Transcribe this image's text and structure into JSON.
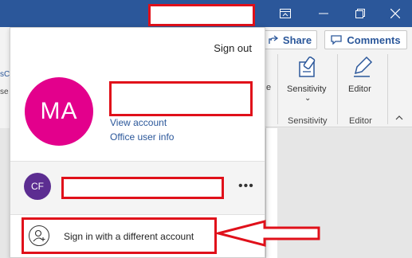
{
  "window": {
    "controls": {
      "ribbon_display_icon": "ribbon-display-icon",
      "minimize_icon": "minimize-icon",
      "restore_icon": "restore-icon",
      "close_icon": "close-icon"
    }
  },
  "toolbar": {
    "share_label": "Share",
    "comments_label": "Comments"
  },
  "ribbon": {
    "sensitivity_button": "Sensitivity",
    "sensitivity_dropdown": "⌄",
    "sensitivity_group": "Sensitivity",
    "editor_button": "Editor",
    "editor_group": "Editor",
    "left_cut_text_1": "sCo",
    "left_cut_text_2": "se",
    "left_cut_text_3": "e"
  },
  "account_panel": {
    "sign_out": "Sign out",
    "avatar_initials": "MA",
    "view_account": "View account",
    "office_user_info": "Office user info",
    "other_account_initials": "CF",
    "more_options": "•••",
    "sign_in_different": "Sign in with a different account"
  },
  "colors": {
    "title_bar": "#2b579a",
    "avatar_ma": "#e3008c",
    "avatar_cf": "#5c2d91",
    "annotation_red": "#e0101a"
  }
}
